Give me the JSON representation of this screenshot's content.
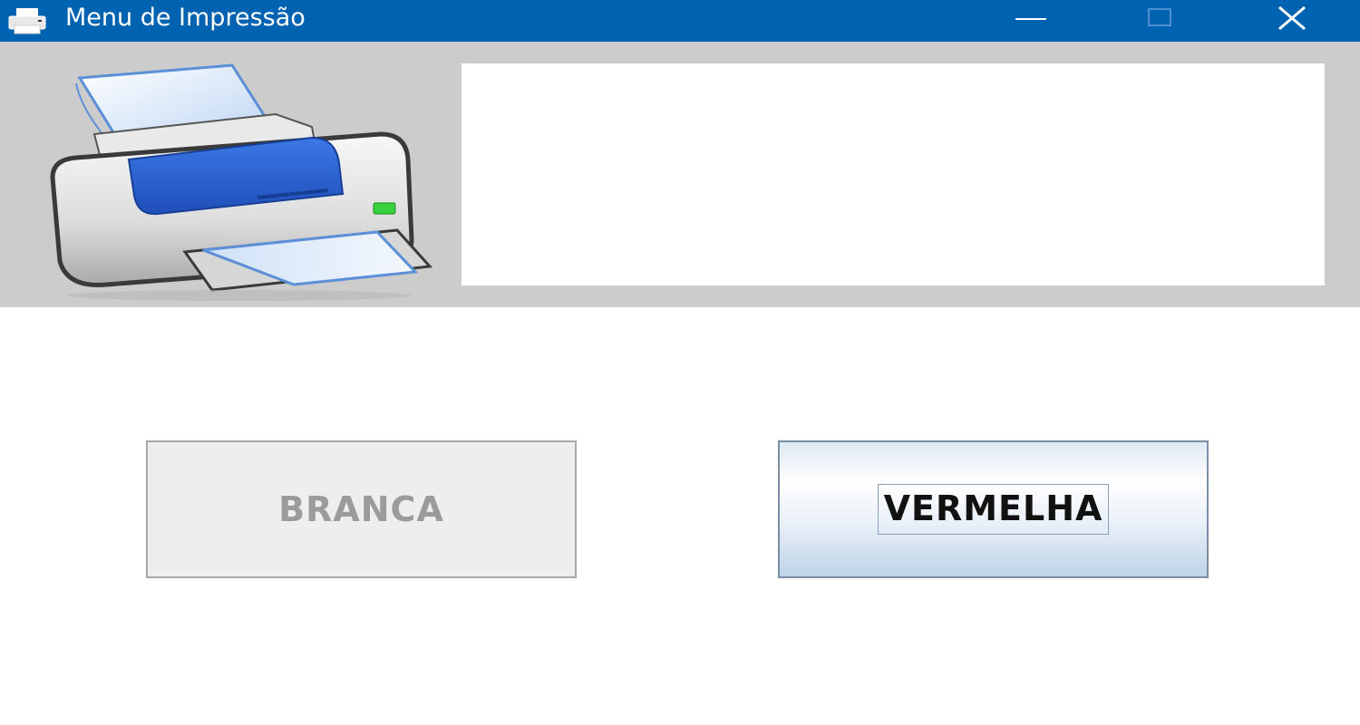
{
  "window": {
    "title": "Menu de Impressão",
    "title_icon": "printer-icon",
    "controls": {
      "minimize": "minimize-icon",
      "maximize": "maximize-icon",
      "close": "close-icon"
    },
    "titlebar_color": "#0063b1"
  },
  "header": {
    "image": "printer-illustration",
    "message_text": "",
    "panel_color": "#cccccc"
  },
  "buttons": {
    "branca": {
      "label": "BRANCA",
      "state": "disabled"
    },
    "vermelha": {
      "label": "VERMELHA",
      "state": "focused"
    }
  }
}
